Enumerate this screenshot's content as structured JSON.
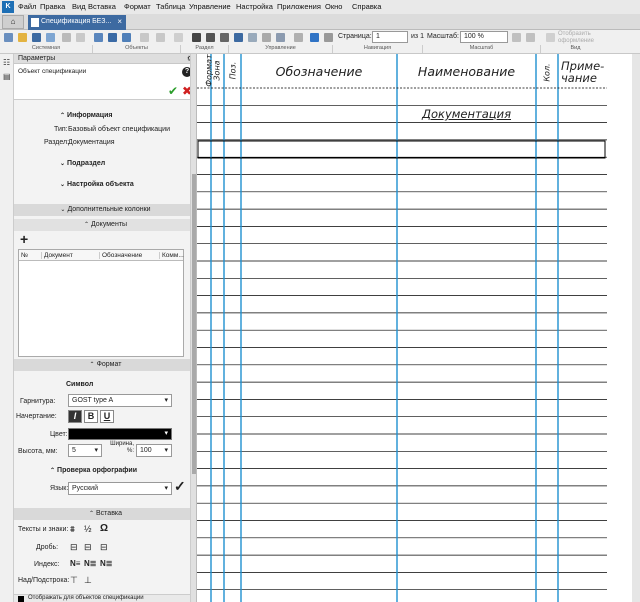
{
  "menubar": {
    "logo": "K",
    "items": [
      "Файл",
      "Правка",
      "Вид",
      "Вставка",
      "Формат",
      "Таблица",
      "Управление",
      "Настройка",
      "Приложения",
      "Окно",
      "Справка"
    ]
  },
  "tabs": {
    "home": "⌂",
    "doc_title": "Спецификация БЕЗ...",
    "close": "×"
  },
  "toolbar": {
    "page_label": "Страница:",
    "page_value": "1",
    "page_of": "из 1",
    "scale_label": "Масштаб:",
    "scale_value": "100 %",
    "render_label": "Отобразить оформление",
    "groups": [
      "Системная",
      "Объекты",
      "Раздел",
      "Управление",
      "Навигация",
      "Масштаб",
      "Вид"
    ]
  },
  "panel": {
    "title": "Параметры",
    "gear": "⚙",
    "object_label": "Объект спецификации",
    "help": "?",
    "ok": "✔",
    "cancel": "✖",
    "info": {
      "title": "Информация",
      "type_label": "Тип:",
      "type_value": "Базовый объект спецификации",
      "section_label": "Раздел:",
      "section_value": "Документация"
    },
    "subsection": "Подраздел",
    "object_settings": "Настройка объекта",
    "extra_columns": "Дополнительные колонки",
    "documents": {
      "title": "Документы",
      "add": "+",
      "columns": [
        "№",
        "Документ",
        "Обозначение",
        "Комм..."
      ]
    },
    "format": {
      "title": "Формат",
      "symbol": "Символ",
      "font_label": "Гарнитура:",
      "font_value": "GOST type A",
      "style_label": "Начертание:",
      "italic": "I",
      "bold": "B",
      "underline": "U",
      "color_label": "Цвет:",
      "color_value": "#000000",
      "height_label": "Высота, мм:",
      "height_value": "5",
      "width_label": "Ширина, %:",
      "width_value": "100",
      "spell_title": "Проверка орфографии",
      "lang_label": "Язык:",
      "lang_value": "Русский"
    },
    "insert": {
      "title": "Вставка",
      "texts_label": "Тексты и знаки:",
      "fraction_label": "Дробь:",
      "index_label": "Индекс:",
      "superscript_label": "Над/Подстрока:",
      "footer_label": "Отображать для объектов спецификации"
    }
  },
  "spec": {
    "headers": {
      "format": "Формат",
      "zone": "Зона",
      "pos": "Поз.",
      "designation": "Обозначение",
      "name": "Наименование",
      "qty": "Кол.",
      "note1": "Приме-",
      "note2": "чание"
    },
    "section_row": "Документация",
    "row_count": 30
  },
  "colors": {
    "accent": "#3d6aa1",
    "ok_green": "#2a9d2a",
    "cancel_red": "#d02020",
    "column_blue": "#1e90d0"
  }
}
